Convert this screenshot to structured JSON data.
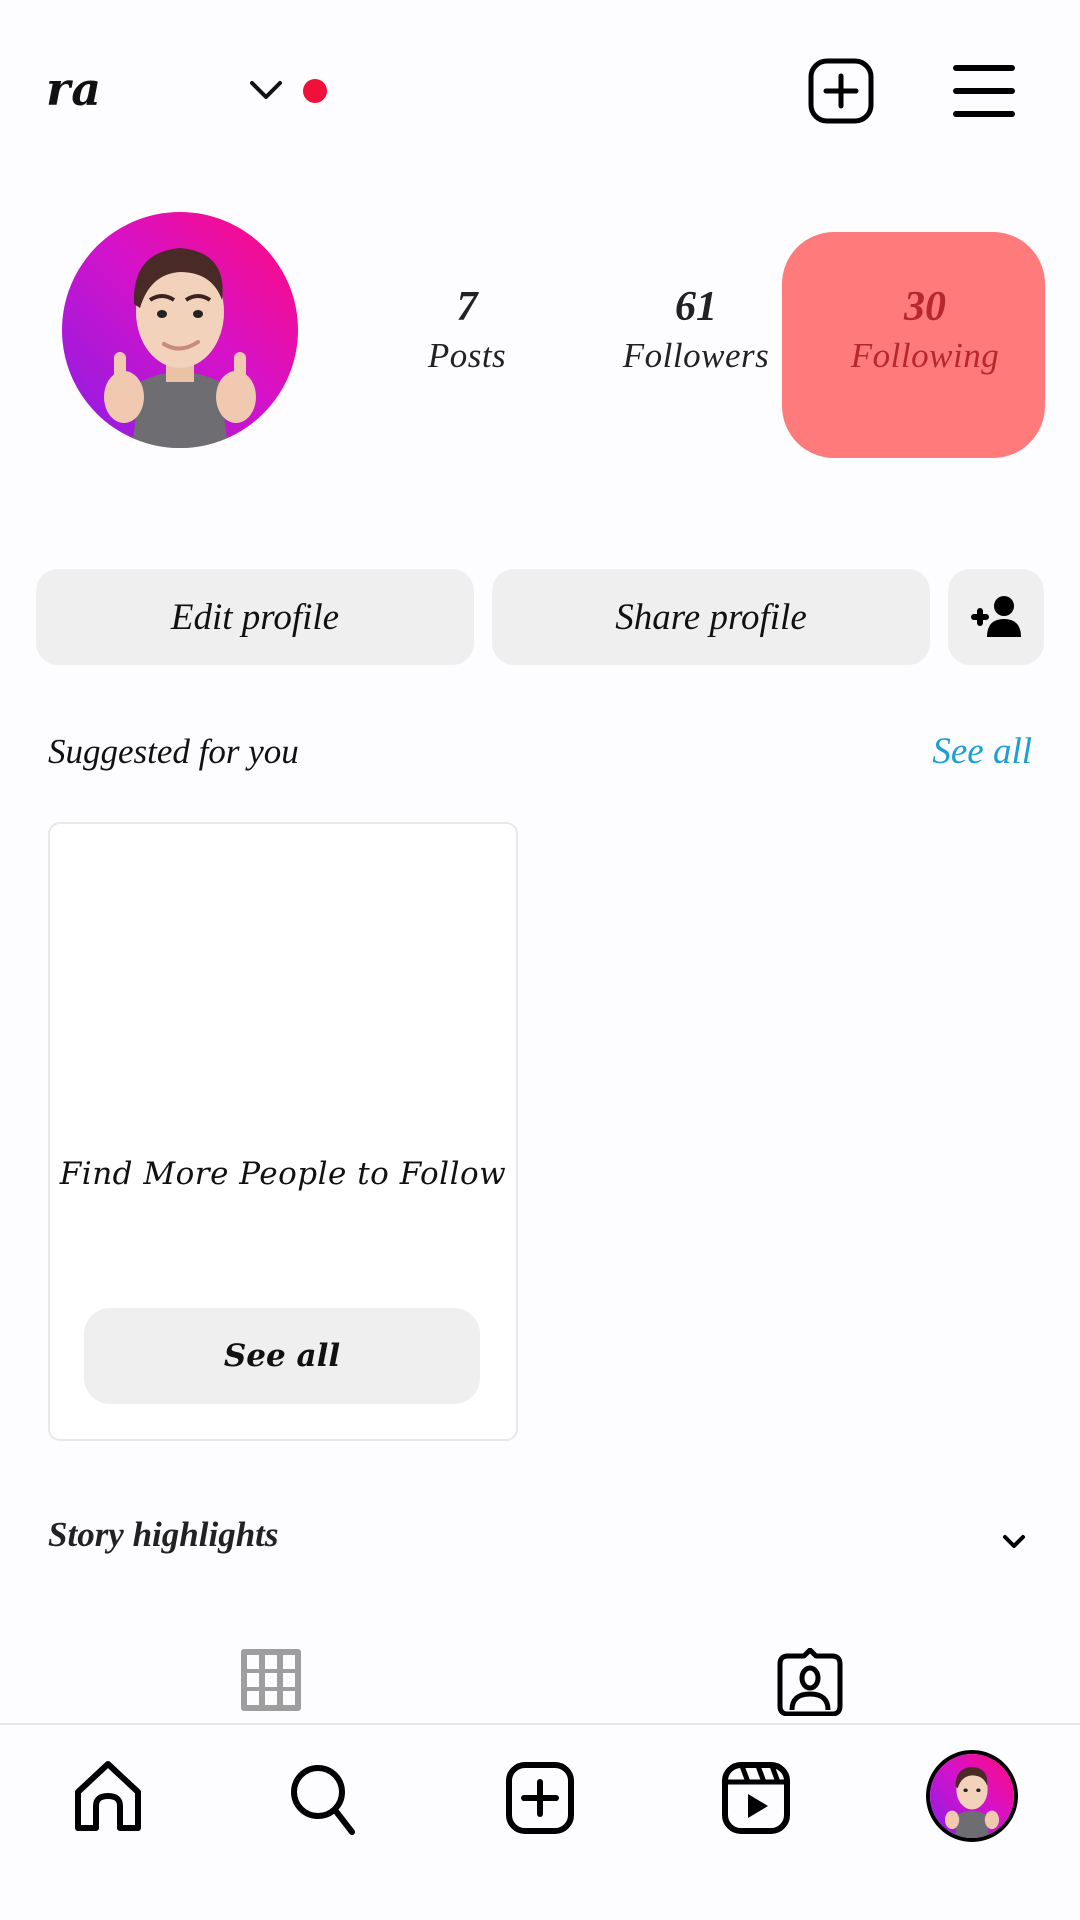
{
  "header": {
    "username": "ra",
    "account_switch_icon": "chevron-down-icon",
    "notification_dot_color": "#f0103a",
    "create_icon": "plus-square-icon",
    "menu_icon": "hamburger-menu-icon"
  },
  "profile": {
    "avatar": "avatar-thumbs-up-memoji",
    "stats": [
      {
        "value": "7",
        "label": "Posts"
      },
      {
        "value": "61",
        "label": "Followers"
      },
      {
        "value": "30",
        "label": "Following",
        "highlighted": true,
        "highlight_color": "#ff7b7b"
      }
    ]
  },
  "actions": {
    "edit_profile": "Edit profile",
    "share_profile": "Share profile",
    "discover_people_icon": "add-person-icon"
  },
  "suggested": {
    "title": "Suggested for you",
    "see_all": "See all",
    "see_all_color": "#1a9fd6",
    "card": {
      "text": "Find More People to Follow",
      "button": "See all"
    }
  },
  "highlights": {
    "title": "Story highlights",
    "toggle_icon": "chevron-down-icon"
  },
  "content_tabs": [
    {
      "name": "posts-grid",
      "icon": "grid-icon",
      "active": false
    },
    {
      "name": "tagged",
      "icon": "tagged-person-icon",
      "active": true
    }
  ],
  "bottom_nav": [
    {
      "name": "home",
      "icon": "home-icon"
    },
    {
      "name": "search",
      "icon": "search-icon"
    },
    {
      "name": "create",
      "icon": "plus-square-icon"
    },
    {
      "name": "reels",
      "icon": "reels-icon"
    },
    {
      "name": "profile",
      "icon": "avatar",
      "active": true
    }
  ]
}
